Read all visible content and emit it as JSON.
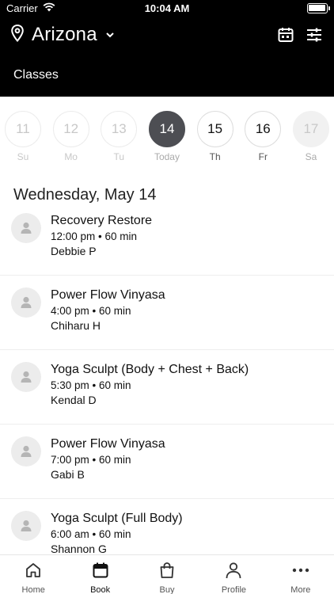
{
  "status_bar": {
    "carrier": "Carrier",
    "time": "10:04 AM"
  },
  "header": {
    "location": "Arizona",
    "section_title": "Classes",
    "icons": [
      "location-pin-icon",
      "chevron-down-icon",
      "calendar-icon",
      "filter-sliders-icon"
    ]
  },
  "dates": [
    {
      "num": "11",
      "label": "Su",
      "state": "past"
    },
    {
      "num": "12",
      "label": "Mo",
      "state": "past"
    },
    {
      "num": "13",
      "label": "Tu",
      "state": "past"
    },
    {
      "num": "14",
      "label": "Today",
      "state": "selected"
    },
    {
      "num": "15",
      "label": "Th",
      "state": "future"
    },
    {
      "num": "16",
      "label": "Fr",
      "state": "future"
    },
    {
      "num": "17",
      "label": "Sa",
      "state": "disabled"
    }
  ],
  "date_heading": "Wednesday, May 14",
  "classes": [
    {
      "name": "Recovery Restore",
      "time": "12:00 pm • 60 min",
      "teacher": "Debbie P"
    },
    {
      "name": "Power Flow Vinyasa",
      "time": "4:00 pm • 60 min",
      "teacher": "Chiharu H"
    },
    {
      "name": "Yoga Sculpt (Body + Chest + Back)",
      "time": "5:30 pm • 60 min",
      "teacher": "Kendal D"
    },
    {
      "name": "Power Flow Vinyasa",
      "time": "7:00 pm • 60 min",
      "teacher": "Gabi B"
    },
    {
      "name": "Yoga Sculpt (Full Body)",
      "time": "6:00 am • 60 min",
      "teacher": "Shannon G"
    }
  ],
  "tabs": [
    {
      "label": "Home",
      "icon": "home-icon",
      "active": false
    },
    {
      "label": "Book",
      "icon": "calendar-icon",
      "active": true
    },
    {
      "label": "Buy",
      "icon": "shopping-bag-icon",
      "active": false
    },
    {
      "label": "Profile",
      "icon": "person-icon",
      "active": false
    },
    {
      "label": "More",
      "icon": "more-dots-icon",
      "active": false
    }
  ],
  "colors": {
    "header_bg": "#000000",
    "selected_day": "#4d4e53",
    "avatar_bg": "#ececec"
  }
}
